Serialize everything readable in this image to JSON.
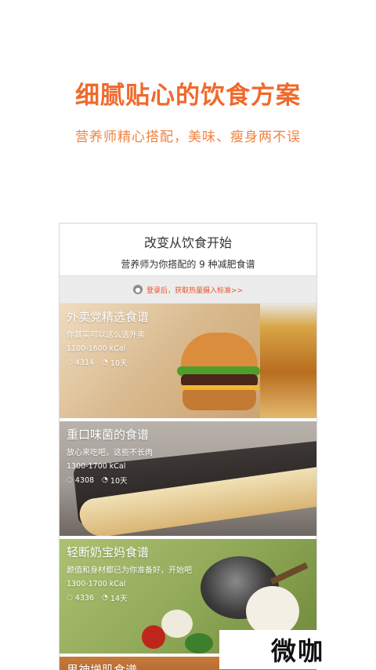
{
  "headline": "细腻贴心的饮食方案",
  "subline": "营养师精心搭配，美味、瘦身两不误",
  "phone": {
    "title": "改变从饮食开始",
    "subtitle": "营养师为你搭配的 9 种减肥食谱",
    "login_text": "登录后，获取热量摄入标准>>"
  },
  "cards": [
    {
      "name": "外卖党精选食谱",
      "desc": "你其实可以这么选外卖",
      "kcal": "1100-1600 kCal",
      "users": "4314",
      "days": "10天"
    },
    {
      "name": "重口味菌的食谱",
      "desc": "放心来吃吧，这些不长肉",
      "kcal": "1300-1700 kCal",
      "users": "4308",
      "days": "10天"
    },
    {
      "name": "轻断奶宝妈食谱",
      "desc": "颜值和身材都已为你准备好，开始吧",
      "kcal": "1300-1700 kCal",
      "users": "4336",
      "days": "14天"
    },
    {
      "name": "男神增肌食谱"
    }
  ],
  "watermark": "微咖",
  "colors": {
    "accent": "#ef6a2c",
    "login": "#e8532a"
  }
}
